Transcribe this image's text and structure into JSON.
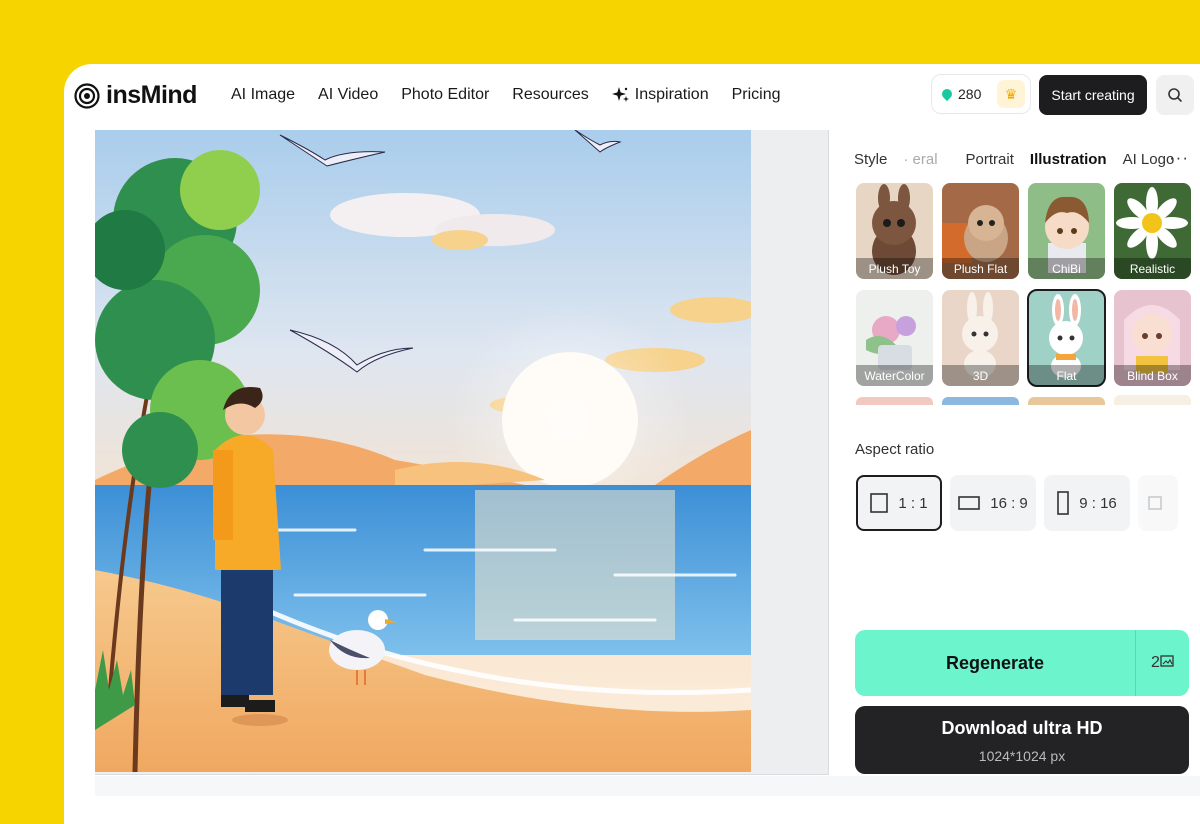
{
  "brand": {
    "name": "insMind"
  },
  "nav": {
    "items": [
      {
        "label": "AI Image"
      },
      {
        "label": "AI Video"
      },
      {
        "label": "Photo Editor"
      },
      {
        "label": "Resources"
      },
      {
        "label": "Inspiration",
        "icon": "sparkle-icon"
      },
      {
        "label": "Pricing"
      }
    ],
    "credits": "280",
    "start_label": "Start creating"
  },
  "panel": {
    "style_label": "Style",
    "style_tabs": [
      "eral",
      "Portrait",
      "Illustration",
      "AI Logo"
    ],
    "active_style_tab": "Illustration",
    "styles": [
      {
        "label": "Plush Toy"
      },
      {
        "label": "Plush Flat"
      },
      {
        "label": "ChiBi"
      },
      {
        "label": "Realistic"
      },
      {
        "label": "WaterColor"
      },
      {
        "label": "3D"
      },
      {
        "label": "Flat",
        "selected": true
      },
      {
        "label": "Blind Box"
      }
    ],
    "aspect_label": "Aspect ratio",
    "ratios": [
      {
        "label": "1 : 1",
        "active": true
      },
      {
        "label": "16 : 9"
      },
      {
        "label": "9 : 16"
      }
    ],
    "regenerate_label": "Regenerate",
    "regenerate_cost": "2",
    "download_label": "Download ultra HD",
    "download_size": "1024*1024 px"
  },
  "colors": {
    "background": "#F5D400",
    "regenerate": "#6CF5CC",
    "download": "#232325"
  }
}
